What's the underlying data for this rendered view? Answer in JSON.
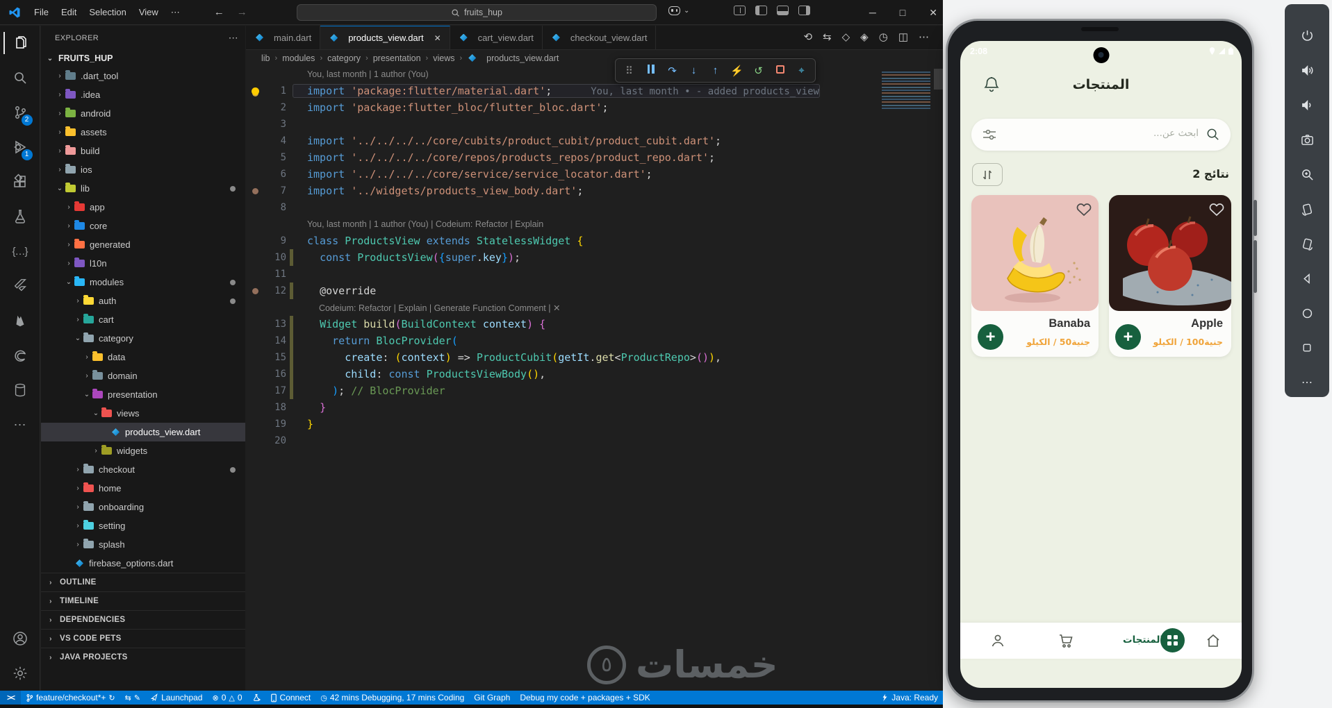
{
  "icons": {
    "more_h": "⋯",
    "chevron_down": "⌄",
    "chevron_right": "›",
    "back_arrow": "←",
    "forward_arrow": "→",
    "window_minimize": "─",
    "window_maximize": "□",
    "window_close": "✕",
    "tab_close": "✕",
    "braces": "{…}",
    "remote": "><"
  },
  "titlebar": {
    "menus": [
      "File",
      "Edit",
      "Selection",
      "View"
    ],
    "search_value": "fruits_hup"
  },
  "activitybar": {
    "scm_badge": "2",
    "debug_badge": "1"
  },
  "explorer": {
    "header": "EXPLORER",
    "root": "FRUITS_HUP",
    "tree": [
      {
        "label": ".dart_tool",
        "lvl": 1,
        "kind": "folder",
        "color": "#607d8b"
      },
      {
        "label": ".idea",
        "lvl": 1,
        "kind": "folder",
        "color": "#7e57c2"
      },
      {
        "label": "android",
        "lvl": 1,
        "kind": "folder",
        "color": "#7cb342"
      },
      {
        "label": "assets",
        "lvl": 1,
        "kind": "folder",
        "color": "#fbc02d"
      },
      {
        "label": "build",
        "lvl": 1,
        "kind": "folder",
        "color": "#ef9a9a"
      },
      {
        "label": "ios",
        "lvl": 1,
        "kind": "folder",
        "color": "#90a4ae"
      },
      {
        "label": "lib",
        "lvl": 1,
        "kind": "folder",
        "color": "#c0ca33",
        "open": true,
        "dot": true
      },
      {
        "label": "app",
        "lvl": 2,
        "kind": "folder",
        "color": "#e53935"
      },
      {
        "label": "core",
        "lvl": 2,
        "kind": "folder",
        "color": "#1e88e5"
      },
      {
        "label": "generated",
        "lvl": 2,
        "kind": "folder",
        "color": "#ff7043"
      },
      {
        "label": "l10n",
        "lvl": 2,
        "kind": "folder",
        "color": "#7e57c2"
      },
      {
        "label": "modules",
        "lvl": 2,
        "kind": "folder",
        "color": "#29b6f6",
        "open": true,
        "dot": true
      },
      {
        "label": "auth",
        "lvl": 3,
        "kind": "folder",
        "color": "#fdd835",
        "dot": true
      },
      {
        "label": "cart",
        "lvl": 3,
        "kind": "folder",
        "color": "#26a69a"
      },
      {
        "label": "category",
        "lvl": 3,
        "kind": "folder",
        "color": "#90a4ae",
        "open": true
      },
      {
        "label": "data",
        "lvl": 4,
        "kind": "folder",
        "color": "#fbc02d"
      },
      {
        "label": "domain",
        "lvl": 4,
        "kind": "folder",
        "color": "#78909c"
      },
      {
        "label": "presentation",
        "lvl": 4,
        "kind": "folder",
        "color": "#ab47bc",
        "open": true
      },
      {
        "label": "views",
        "lvl": 5,
        "kind": "folder",
        "color": "#ef5350",
        "open": true
      },
      {
        "label": "products_view.dart",
        "lvl": 6,
        "kind": "dart",
        "selected": true
      },
      {
        "label": "widgets",
        "lvl": 5,
        "kind": "folder",
        "color": "#9e9d24"
      },
      {
        "label": "checkout",
        "lvl": 3,
        "kind": "folder",
        "color": "#90a4ae",
        "dot": true
      },
      {
        "label": "home",
        "lvl": 3,
        "kind": "folder",
        "color": "#ef5350"
      },
      {
        "label": "onboarding",
        "lvl": 3,
        "kind": "folder",
        "color": "#90a4ae"
      },
      {
        "label": "setting",
        "lvl": 3,
        "kind": "folder",
        "color": "#4dd0e1"
      },
      {
        "label": "splash",
        "lvl": 3,
        "kind": "folder",
        "color": "#90a4ae"
      },
      {
        "label": "firebase_options.dart",
        "lvl": 2,
        "kind": "dart"
      }
    ],
    "sections": [
      "OUTLINE",
      "TIMELINE",
      "DEPENDENCIES",
      "VS CODE PETS",
      "JAVA PROJECTS"
    ]
  },
  "tabs": [
    {
      "label": "main.dart"
    },
    {
      "label": "products_view.dart",
      "active": true
    },
    {
      "label": "cart_view.dart"
    },
    {
      "label": "checkout_view.dart"
    }
  ],
  "breadcrumbs": [
    "lib",
    "modules",
    "category",
    "presentation",
    "views",
    "products_view.dart"
  ],
  "editor_actions": [
    {
      "name": "timeline-icon",
      "glyph": "⟲"
    },
    {
      "name": "swap-icon",
      "glyph": "⇆"
    },
    {
      "name": "devtools-icon",
      "glyph": "◇"
    },
    {
      "name": "devtools-launch-icon",
      "glyph": "◈"
    },
    {
      "name": "profile-run-icon",
      "glyph": "◷"
    },
    {
      "name": "split-editor-icon",
      "glyph": "◫"
    },
    {
      "name": "more-actions-icon",
      "glyph": "⋯"
    }
  ],
  "debug_toolbar": [
    {
      "name": "drag-grip-icon",
      "glyph": "⠿",
      "color": "#8a8a8a"
    },
    {
      "name": "pause-icon",
      "glyph": "",
      "color": "#75beff"
    },
    {
      "name": "step-over-icon",
      "glyph": "↷",
      "color": "#75beff"
    },
    {
      "name": "step-into-icon",
      "glyph": "↓",
      "color": "#75beff"
    },
    {
      "name": "step-out-icon",
      "glyph": "↑",
      "color": "#75beff"
    },
    {
      "name": "hot-reload-icon",
      "glyph": "⚡",
      "color": "#ffc83d"
    },
    {
      "name": "restart-icon",
      "glyph": "↺",
      "color": "#89d185"
    },
    {
      "name": "stop-icon",
      "glyph": "",
      "color": "#f48771"
    },
    {
      "name": "widget-inspector-icon",
      "glyph": "⌖",
      "color": "#4fc1e9"
    }
  ],
  "editor": {
    "blame_top": "You, last month | 1 author (You)",
    "blame_mid": "You, last month | 1 author (You) | Codeium: Refactor | Explain",
    "codelens": "Codeium: Refactor | Explain | Generate Function Comment | ✕",
    "ghost": "You, last month • - added products_view",
    "rows": [
      {
        "t": "meta",
        "key": "blame_top"
      },
      {
        "t": "code",
        "n": 1,
        "bulb": 1,
        "hl": 1
      },
      {
        "t": "code",
        "n": 2
      },
      {
        "t": "code",
        "n": 3
      },
      {
        "t": "code",
        "n": 4
      },
      {
        "t": "code",
        "n": 5
      },
      {
        "t": "code",
        "n": 6
      },
      {
        "t": "code",
        "n": 7,
        "dot": 1
      },
      {
        "t": "code",
        "n": 8
      },
      {
        "t": "meta",
        "key": "blame_mid"
      },
      {
        "t": "code",
        "n": 9
      },
      {
        "t": "code",
        "n": 10,
        "git": 1
      },
      {
        "t": "code",
        "n": 11
      },
      {
        "t": "code",
        "n": 12,
        "git": 1,
        "dot": 1
      },
      {
        "t": "lens",
        "key": "codelens",
        "git": 1,
        "dot": 1
      },
      {
        "t": "code",
        "n": 13,
        "git": 1
      },
      {
        "t": "code",
        "n": 14,
        "git": 1
      },
      {
        "t": "code",
        "n": 15,
        "git": 1
      },
      {
        "t": "code",
        "n": 16,
        "git": 1
      },
      {
        "t": "code",
        "n": 17,
        "git": 1
      },
      {
        "t": "code",
        "n": 18
      },
      {
        "t": "code",
        "n": 19
      },
      {
        "t": "code",
        "n": 20
      }
    ],
    "lines": {
      "1": [
        [
          "kw",
          "import"
        ],
        [
          "pun",
          " "
        ],
        [
          "str",
          "'package:flutter/material.dart'"
        ],
        [
          "pun",
          ";"
        ],
        [
          "ghost",
          "You, last month • - added products_view"
        ]
      ],
      "2": [
        [
          "kw",
          "import"
        ],
        [
          "pun",
          " "
        ],
        [
          "str",
          "'package:flutter_bloc/flutter_bloc.dart'"
        ],
        [
          "pun",
          ";"
        ]
      ],
      "3": [],
      "4": [
        [
          "kw",
          "import"
        ],
        [
          "pun",
          " "
        ],
        [
          "str",
          "'../../../../core/cubits/product_cubit/product_cubit.dart'"
        ],
        [
          "pun",
          ";"
        ]
      ],
      "5": [
        [
          "kw",
          "import"
        ],
        [
          "pun",
          " "
        ],
        [
          "str",
          "'../../../../core/repos/products_repos/product_repo.dart'"
        ],
        [
          "pun",
          ";"
        ]
      ],
      "6": [
        [
          "kw",
          "import"
        ],
        [
          "pun",
          " "
        ],
        [
          "str",
          "'../../../../core/service/service_locator.dart'"
        ],
        [
          "pun",
          ";"
        ]
      ],
      "7": [
        [
          "kw",
          "import"
        ],
        [
          "pun",
          " "
        ],
        [
          "str",
          "'../widgets/products_view_body.dart'"
        ],
        [
          "pun",
          ";"
        ]
      ],
      "8": [],
      "9": [
        [
          "kw",
          "class"
        ],
        [
          "pun",
          " "
        ],
        [
          "typ",
          "ProductsView"
        ],
        [
          "kw",
          " extends"
        ],
        [
          "pun",
          " "
        ],
        [
          "typ",
          "StatelessWidget"
        ],
        [
          "b1",
          " {"
        ]
      ],
      "10": [
        [
          "pun",
          "  "
        ],
        [
          "kw",
          "const"
        ],
        [
          "pun",
          " "
        ],
        [
          "typ",
          "ProductsView"
        ],
        [
          "b2",
          "("
        ],
        [
          "b3",
          "{"
        ],
        [
          "kw",
          "super"
        ],
        [
          "pun",
          "."
        ],
        [
          "var",
          "key"
        ],
        [
          "b3",
          "}"
        ],
        [
          "b2",
          ")"
        ],
        [
          "pun",
          ";"
        ]
      ],
      "11": [],
      "12": [
        [
          "pun",
          "  "
        ],
        [
          "ann",
          "@override"
        ]
      ],
      "13": [
        [
          "pun",
          "  "
        ],
        [
          "typ",
          "Widget"
        ],
        [
          "pun",
          " "
        ],
        [
          "fn",
          "build"
        ],
        [
          "b2",
          "("
        ],
        [
          "typ",
          "BuildContext"
        ],
        [
          "pun",
          " "
        ],
        [
          "var",
          "context"
        ],
        [
          "b2",
          ")"
        ],
        [
          "b2",
          " {"
        ]
      ],
      "14": [
        [
          "pun",
          "    "
        ],
        [
          "kw",
          "return"
        ],
        [
          "pun",
          " "
        ],
        [
          "typ",
          "BlocProvider"
        ],
        [
          "b3",
          "("
        ]
      ],
      "15": [
        [
          "pun",
          "      "
        ],
        [
          "var",
          "create"
        ],
        [
          "pun",
          ": "
        ],
        [
          "b1",
          "("
        ],
        [
          "var",
          "context"
        ],
        [
          "b1",
          ")"
        ],
        [
          "pun",
          " => "
        ],
        [
          "typ",
          "ProductCubit"
        ],
        [
          "b1",
          "("
        ],
        [
          "var",
          "getIt"
        ],
        [
          "pun",
          "."
        ],
        [
          "fn",
          "get"
        ],
        [
          "pun",
          "<"
        ],
        [
          "typ",
          "ProductRepo"
        ],
        [
          "pun",
          ">"
        ],
        [
          "b2",
          "()"
        ],
        [
          "b1",
          ")"
        ],
        [
          "pun",
          ","
        ]
      ],
      "16": [
        [
          "pun",
          "      "
        ],
        [
          "var",
          "child"
        ],
        [
          "pun",
          ": "
        ],
        [
          "kw",
          "const"
        ],
        [
          "pun",
          " "
        ],
        [
          "typ",
          "ProductsViewBody"
        ],
        [
          "b1",
          "()"
        ],
        [
          "pun",
          ","
        ]
      ],
      "17": [
        [
          "pun",
          "    "
        ],
        [
          "b3",
          ")"
        ],
        [
          "pun",
          ";"
        ],
        [
          "com",
          " // BlocProvider"
        ]
      ],
      "18": [
        [
          "pun",
          "  "
        ],
        [
          "b2",
          "}"
        ]
      ],
      "19": [
        [
          "b1",
          "}"
        ]
      ],
      "20": []
    }
  },
  "statusbar": {
    "branch": "feature/checkout*+",
    "launchpad": "Launchpad",
    "errors": "0",
    "warnings": "0",
    "connect": "Connect",
    "time_stats": "42 mins Debugging, 17 mins Coding",
    "git_graph": "Git Graph",
    "debug_config": "Debug my code + packages + SDK",
    "java_status": "Java: Ready"
  },
  "watermark": {
    "text": "خمسات",
    "logo": "٥"
  },
  "emulator": {
    "time": "2:08",
    "title": "المنتجات",
    "search_placeholder": "ابحث عن...",
    "results_count": "2 نتائج",
    "products": [
      {
        "name": "Banaba",
        "price": "جنية50 / الكيلو",
        "accent": "#e9c2bc"
      },
      {
        "name": "Apple",
        "price": "جنية100 / الكيلو",
        "accent": "#2b1b17"
      }
    ],
    "nav_label": "المنتجات",
    "colors": {
      "primary_green": "#17603e",
      "price_orange": "#f0a43a",
      "screen_bg": "#edf1e4"
    }
  }
}
